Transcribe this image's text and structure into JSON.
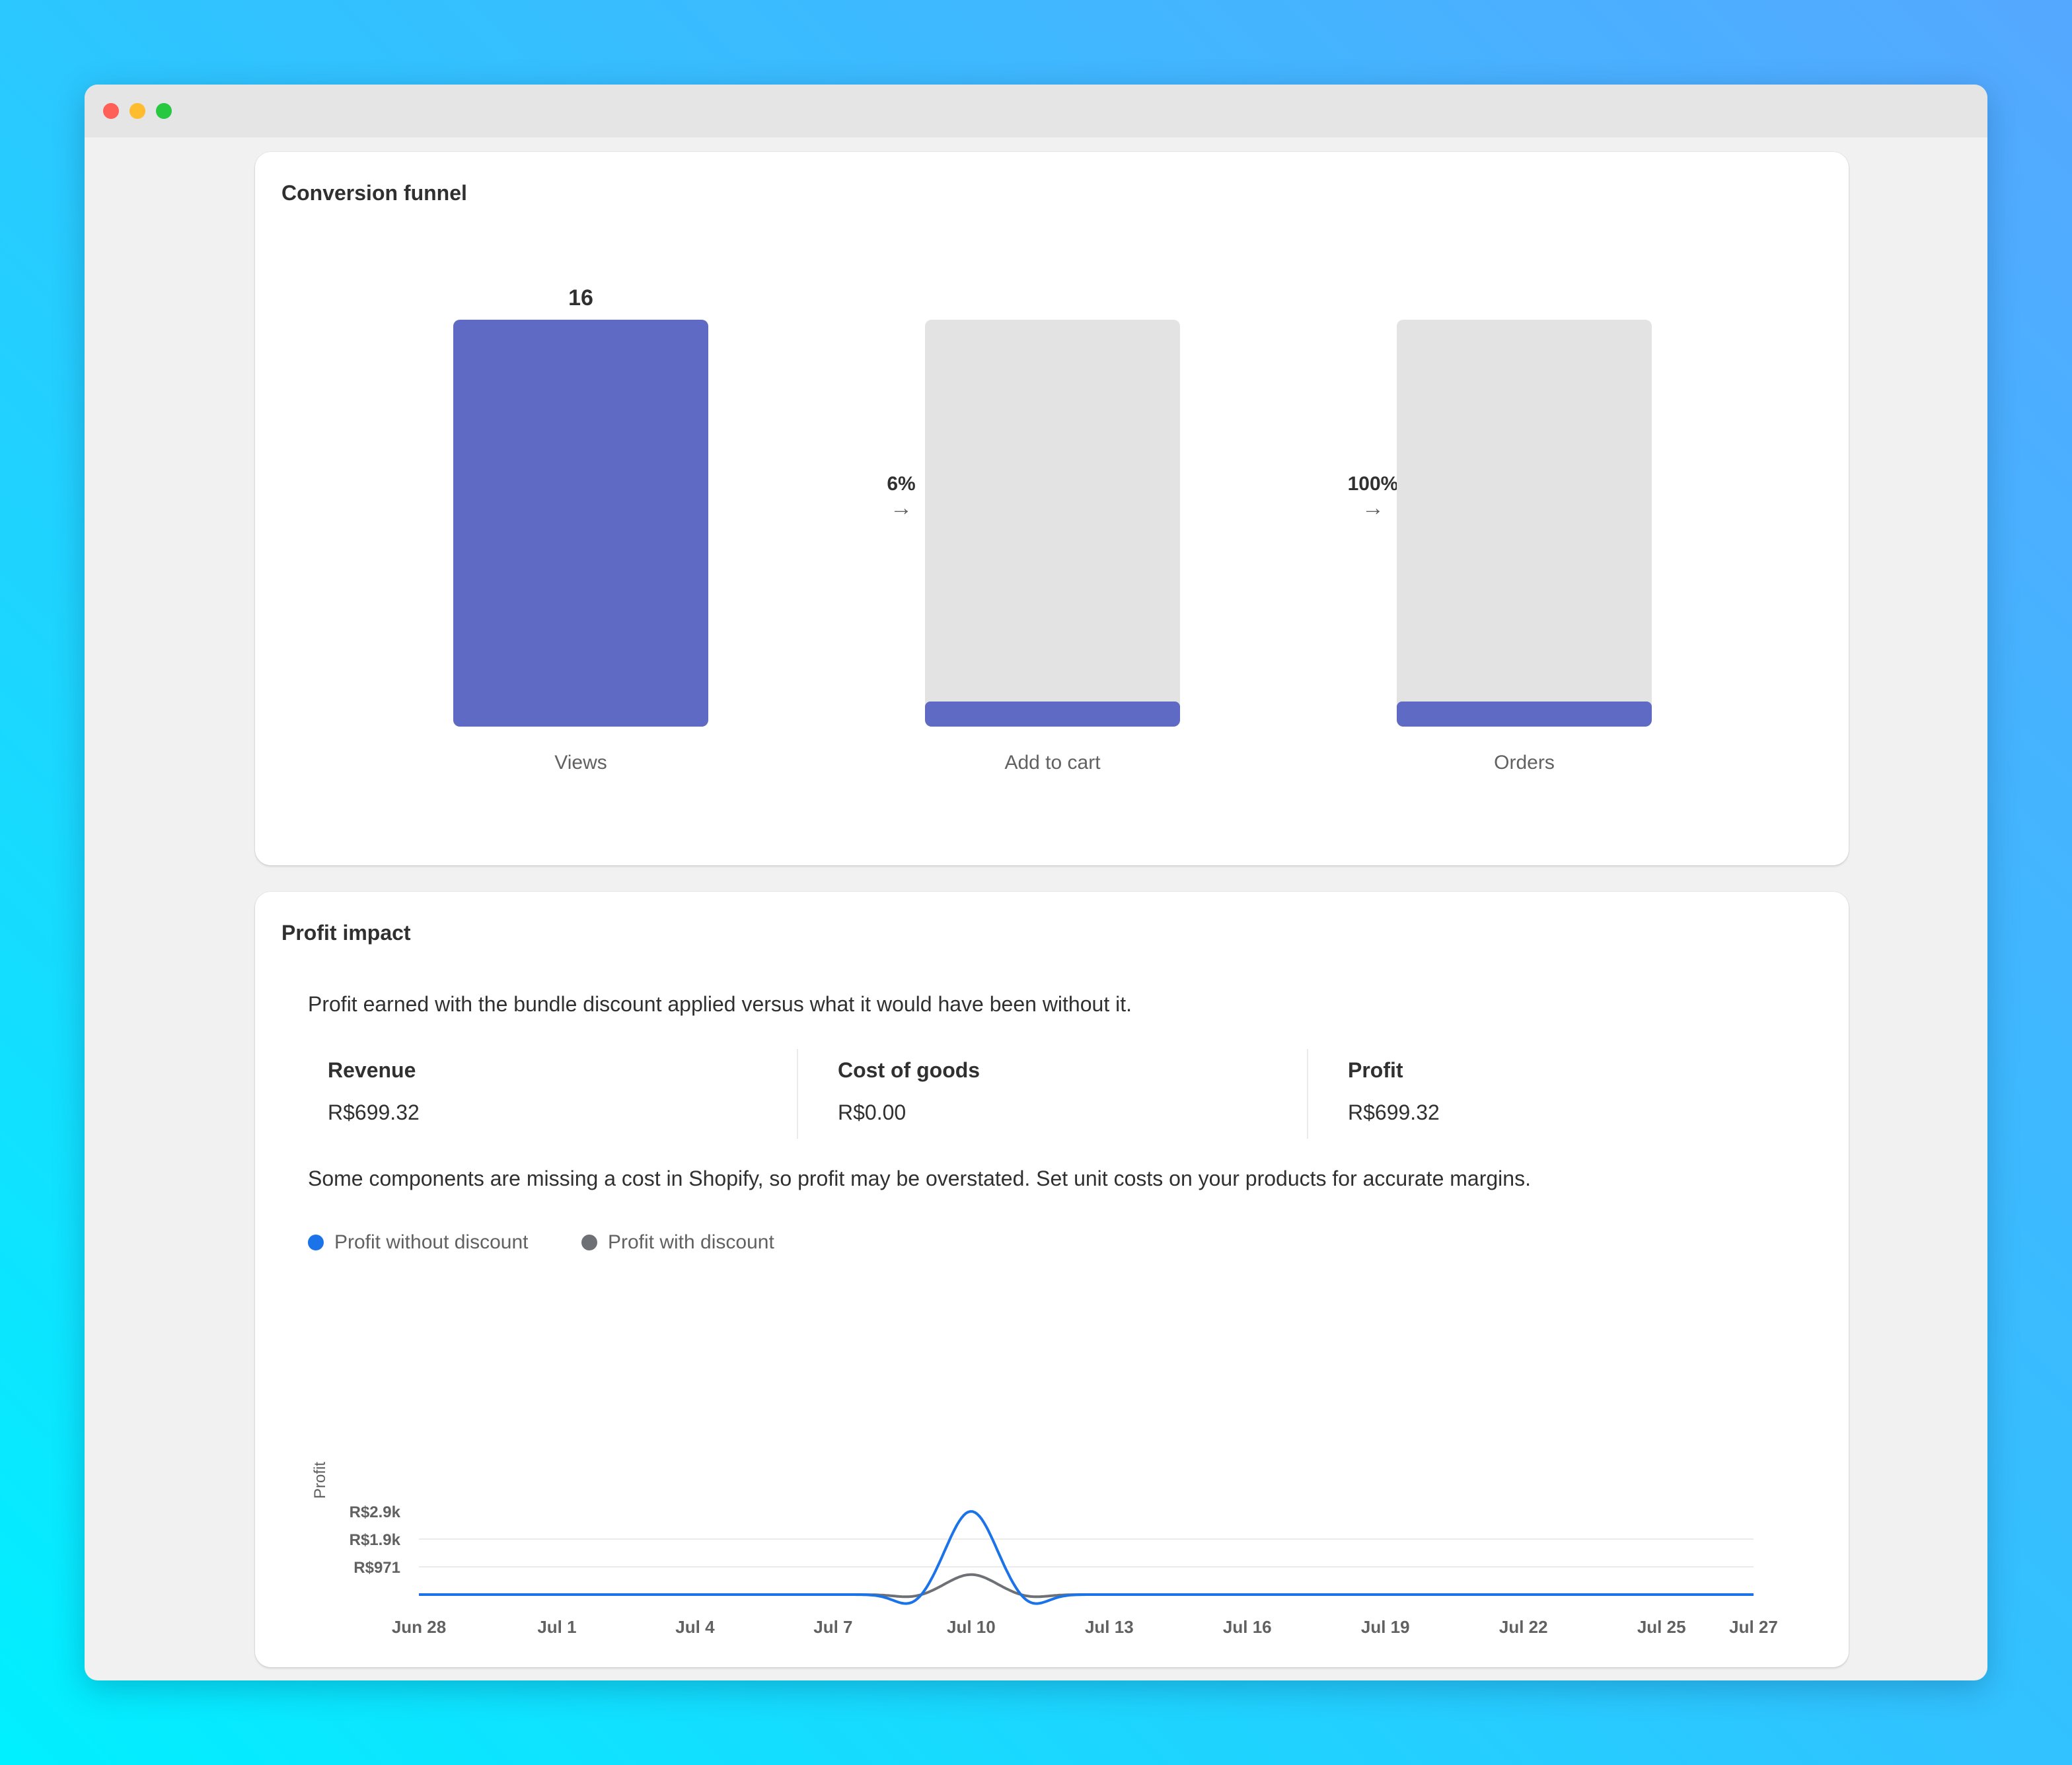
{
  "funnel": {
    "title": "Conversion funnel",
    "max": 16,
    "stages": [
      {
        "label": "Views",
        "value": 16,
        "value_text": "16"
      },
      {
        "label": "Add to cart",
        "value": 1,
        "value_text": "1"
      },
      {
        "label": "Orders",
        "value": 1,
        "value_text": "1"
      }
    ],
    "conversions": [
      {
        "pct": "6%",
        "arrow": "→"
      },
      {
        "pct": "100%",
        "arrow": "→"
      }
    ]
  },
  "profit": {
    "title": "Profit impact",
    "description": "Profit earned with the bundle discount applied versus what it would have been without it.",
    "metrics": [
      {
        "label": "Revenue",
        "value": "R$699.32"
      },
      {
        "label": "Cost of goods",
        "value": "R$0.00"
      },
      {
        "label": "Profit",
        "value": "R$699.32"
      }
    ],
    "warning": "Some components are missing a cost in Shopify, so profit may be overstated. Set unit costs on your products for accurate margins.",
    "legend": [
      {
        "label": "Profit without discount",
        "color": "#1a73e8"
      },
      {
        "label": "Profit with discount",
        "color": "#6d7175"
      }
    ]
  },
  "chart_data": {
    "type": "line",
    "ylabel": "Profit",
    "y_ticks": [
      {
        "value": 971,
        "label": "R$971"
      },
      {
        "value": 1942,
        "label": "R$1.9k"
      },
      {
        "value": 2913,
        "label": "R$2.9k"
      }
    ],
    "ylim": [
      0,
      2913
    ],
    "x_ticks": [
      {
        "day": 0,
        "label": "Jun 28"
      },
      {
        "day": 3,
        "label": "Jul 1"
      },
      {
        "day": 6,
        "label": "Jul 4"
      },
      {
        "day": 9,
        "label": "Jul 7"
      },
      {
        "day": 12,
        "label": "Jul 10"
      },
      {
        "day": 15,
        "label": "Jul 13"
      },
      {
        "day": 18,
        "label": "Jul 16"
      },
      {
        "day": 21,
        "label": "Jul 19"
      },
      {
        "day": 24,
        "label": "Jul 22"
      },
      {
        "day": 27,
        "label": "Jul 25"
      },
      {
        "day": 29,
        "label": "Jul 27"
      }
    ],
    "series": [
      {
        "name": "Profit without discount",
        "color": "#1a73e8",
        "peak_day": 12,
        "peak_value": 2913
      },
      {
        "name": "Profit with discount",
        "color": "#6d7175",
        "peak_day": 12,
        "peak_value": 699.32
      }
    ],
    "grid": true,
    "legend_position": "top-left"
  }
}
